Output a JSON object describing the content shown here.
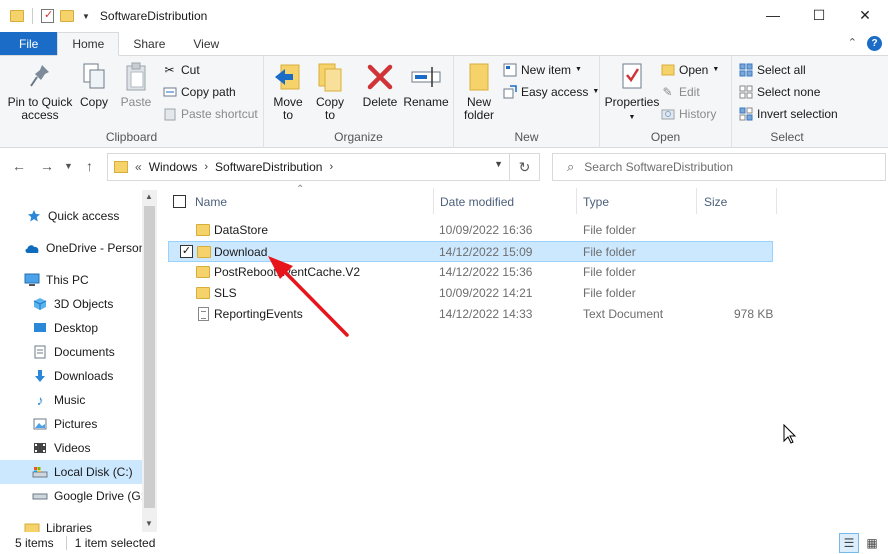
{
  "window": {
    "title": "SoftwareDistribution",
    "controls": [
      "—",
      "☐",
      "✕"
    ]
  },
  "tabs": [
    {
      "label": "File"
    },
    {
      "label": "Home"
    },
    {
      "label": "Share"
    },
    {
      "label": "View"
    }
  ],
  "ribbon": {
    "clipboard": {
      "label": "Clipboard",
      "pin": "Pin to Quick access",
      "pin_l1": "Pin to Quick",
      "pin_l2": "access",
      "copy": "Copy",
      "paste": "Paste",
      "cut": "Cut",
      "copy_path": "Copy path",
      "paste_shortcut": "Paste shortcut"
    },
    "organize": {
      "label": "Organize",
      "move_l1": "Move",
      "move_l2": "to",
      "copy_l1": "Copy",
      "copy_l2": "to",
      "delete": "Delete",
      "rename": "Rename"
    },
    "new": {
      "label": "New",
      "folder_l1": "New",
      "folder_l2": "folder",
      "new_item": "New item",
      "easy_access": "Easy access"
    },
    "open": {
      "label": "Open",
      "properties": "Properties",
      "open": "Open",
      "edit": "Edit",
      "history": "History"
    },
    "select": {
      "label": "Select",
      "select_all": "Select all",
      "select_none": "Select none",
      "invert": "Invert selection"
    }
  },
  "address": {
    "prefix": "«",
    "crumbs": [
      "Windows",
      "SoftwareDistribution"
    ],
    "search_placeholder": "Search SoftwareDistribution"
  },
  "sidebar": {
    "items": [
      {
        "label": "Quick access",
        "icon": "star-icon"
      },
      {
        "label": "OneDrive - Personal",
        "icon": "cloud-icon"
      },
      {
        "label": "This PC",
        "icon": "computer-icon"
      },
      {
        "label": "3D Objects",
        "icon": "cube-icon"
      },
      {
        "label": "Desktop",
        "icon": "desktop-icon"
      },
      {
        "label": "Documents",
        "icon": "documents-icon"
      },
      {
        "label": "Downloads",
        "icon": "download-icon"
      },
      {
        "label": "Music",
        "icon": "music-icon"
      },
      {
        "label": "Pictures",
        "icon": "pictures-icon"
      },
      {
        "label": "Videos",
        "icon": "video-icon"
      },
      {
        "label": "Local Disk (C:)",
        "icon": "drive-icon"
      },
      {
        "label": "Google Drive (G:)",
        "icon": "drive-icon"
      },
      {
        "label": "Libraries",
        "icon": "library-icon"
      }
    ]
  },
  "columns": {
    "name": "Name",
    "date": "Date modified",
    "type": "Type",
    "size": "Size"
  },
  "files": [
    {
      "name": "DataStore",
      "date": "10/09/2022 16:36",
      "type": "File folder",
      "size": "",
      "kind": "folder"
    },
    {
      "name": "Download",
      "date": "14/12/2022 15:09",
      "type": "File folder",
      "size": "",
      "kind": "folder",
      "selected": true
    },
    {
      "name": "PostRebootEventCache.V2",
      "date": "14/12/2022 15:36",
      "type": "File folder",
      "size": "",
      "kind": "folder"
    },
    {
      "name": "SLS",
      "date": "10/09/2022 14:21",
      "type": "File folder",
      "size": "",
      "kind": "folder"
    },
    {
      "name": "ReportingEvents",
      "date": "14/12/2022 14:33",
      "type": "Text Document",
      "size": "978 KB",
      "kind": "text"
    }
  ],
  "status": {
    "count": "5 items",
    "selected": "1 item selected"
  },
  "colors": {
    "accent": "#1a6cc7",
    "selection": "#cce8ff",
    "annotation_arrow": "#e8141c"
  }
}
